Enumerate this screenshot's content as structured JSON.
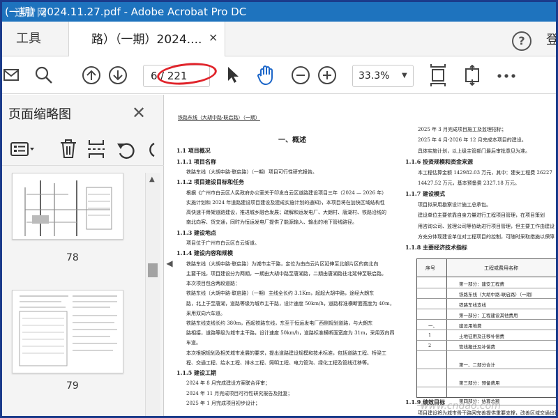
{
  "window": {
    "title": "(一期）2024.11.27.pdf - Adobe Acrobat Pro DC",
    "watermark_logo": "迅雷网"
  },
  "tabs": {
    "tools_label": "工具",
    "doc_tab_label": "路）（一期）2024....",
    "close_glyph": "×",
    "login_label": "登"
  },
  "toolbar": {
    "current_page": "6",
    "total_pages": "/ 221",
    "zoom_value": "33.3%",
    "icons": [
      "mail-icon",
      "search-icon",
      "page-up-icon",
      "page-down-icon",
      "select-cursor-icon",
      "hand-tool-icon",
      "zoom-out-icon",
      "zoom-in-icon",
      "zoom-dropdown-icon",
      "fit-page-icon",
      "full-screen-icon",
      "more-icon"
    ],
    "highlight_color": "#e0232a"
  },
  "panel": {
    "title": "页面缩略图",
    "close_glyph": "✕",
    "thumbnails": [
      {
        "label": "78"
      },
      {
        "label": "79"
      }
    ]
  },
  "document": {
    "header": "铁路东线（大胡中路-联启路）（一期）",
    "section_title": "一、概述",
    "left_col": [
      {
        "text": "1.1 项目概况",
        "heading": true
      },
      {
        "text": "1.1.1 项目名称",
        "heading": true
      },
      {
        "text": "铁路东线（大胡中路-联启路）（一期）项目可行性研究报告。",
        "heading": false
      },
      {
        "text": "1.1.2 项目建设目标和任务",
        "heading": true
      },
      {
        "text": "根据《广州市白云区人民政府办公室关于印发白云区道路建设项目三年（2024 — 2026 年）",
        "heading": false
      },
      {
        "text": "实施计划和 2024 年道路建设项目建设及建成实施计划的通知》，本项目将在加快区域结构性",
        "heading": false
      },
      {
        "text": "高快速干骨架道路建设，推进城乡融合发展；疏解和运发电厂、大朗村、唐湖村、铁路沿线的",
        "heading": false
      },
      {
        "text": "南北向客、货交通，同时为恒运发电厂提供了能源输入、输出的地下管线路径。",
        "heading": false
      },
      {
        "text": "1.1.3 建设地点",
        "heading": true
      },
      {
        "text": "项目位于广州市白云区白云街道。",
        "heading": false
      },
      {
        "text": "1.1.4 建设内容和规模",
        "heading": true
      },
      {
        "text": "铁路东线（大胡中路-联启路）为城市主干路，定位为由白云片区延伸至北部片区的南北向",
        "heading": false
      },
      {
        "text": "主要干线，项目建设分为两期，一期由大胡中路至唐湖路，二期由唐湖路往北延伸至联启路。",
        "heading": false
      },
      {
        "text": "本次项目包含两段道路：",
        "heading": false
      },
      {
        "text": "铁路东线（大胡中路-联启路）（一期）主线全长约 3.1Km，起起大胡中路，途经大朗东",
        "heading": false
      },
      {
        "text": "路，北上于至唐湖，道路等级为城市主干路，设计速度 50km/h，道路标准横断面宽度为 40m，",
        "heading": false
      },
      {
        "text": "采用双向六车道。",
        "heading": false
      },
      {
        "text": "铁路东线支线长约 380m，西起铁路东线，东至于恒运发电厂西侧规划道路，与大朗东",
        "heading": false
      },
      {
        "text": "路相接，道路等级为城市主干路，设计速度 50km/h，道路标准横断面宽度为 31m，采用双向四",
        "heading": false
      },
      {
        "text": "车道。",
        "heading": false
      },
      {
        "text": "本次根据规划及相关城市发展的要求，提出道路建设规模和技术标准，包括道路工程、桥梁工",
        "heading": false
      },
      {
        "text": "程、交通工程、给水工程、排水工程、照明工程、电力管沟、绿化工程及管线迁移等。",
        "heading": false
      },
      {
        "text": "1.1.5 建设工期",
        "heading": true
      },
      {
        "text": "2024 年 8 月完成建设方案联合评审；",
        "heading": false
      },
      {
        "text": "2024 年 11 月完成项目可行性研究报告及批复；",
        "heading": false
      },
      {
        "text": "2025 年 1 月完成项目初步设计；",
        "heading": false
      }
    ],
    "right_col": [
      {
        "text": "2025 年 3 月完成项目施工及监理招标；",
        "heading": false
      },
      {
        "text": "2025 年 4 月-2026 年 12 月完成本项目的建设。",
        "heading": false
      },
      {
        "text": "具体实施计划，以上级主管部门最后审批意见为准。",
        "heading": false
      },
      {
        "text": "1.1.6 投资规模和资金来源",
        "heading": true
      },
      {
        "text": "本工程估算金额 142982.03 万元，其中：建安工程费 26227",
        "heading": false
      },
      {
        "text": "14427.52 万元，基本预备费 2327.18 万元。",
        "heading": false
      },
      {
        "text": "1.1.7 建设模式",
        "heading": true
      },
      {
        "text": "项目拟采用勘察设计施工总承包。",
        "heading": false
      },
      {
        "text": "建设单位主要依靠自身力量进行工程项目管理，在项目策划",
        "heading": false
      },
      {
        "text": "用咨询公司、监理公司等协助进行项目管理，但主要工作由建设",
        "heading": false
      },
      {
        "text": "方充分体现建设单位对工程项目的控制，可随时采取措施以保障",
        "heading": false
      },
      {
        "text": "1.1.8 主要经济技术指标",
        "heading": true
      }
    ],
    "table": {
      "col1_header": "序号",
      "col2_header": "工程或费用名称",
      "rows": [
        {
          "no": "",
          "name": "第一部分：建安工程费"
        },
        {
          "no": "",
          "name": "铁路东线（大胡中路-联启路）（一期）"
        },
        {
          "no": "",
          "name": "铁路东线支线"
        },
        {
          "no": "",
          "name": "第一部分：工程建设其他费用"
        },
        {
          "no": "一、",
          "name": "建设用地费"
        },
        {
          "no": "1",
          "name": "土地征用及迁移补偿费"
        },
        {
          "no": "2",
          "name": "管线搬迁及补偿费"
        },
        {
          "no": "",
          "name": "第一、二部分合计"
        },
        {
          "no": "",
          "name": "第三部分：预备费用"
        },
        {
          "no": "",
          "name": "第四部分：估算总额"
        }
      ]
    },
    "footer_heading": "1.1.9 绩效目标",
    "footer_text": "项目建设将为城市骨干路网完善提供重要支撑，改善区域交通出行条件",
    "bottom_watermark": "www.cndao.com"
  }
}
